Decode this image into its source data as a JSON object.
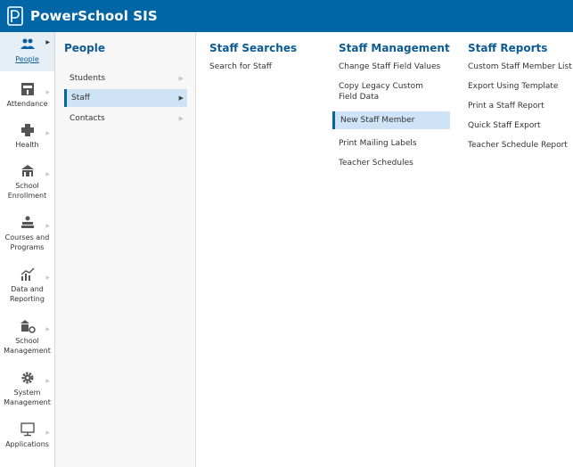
{
  "app": {
    "title": "PowerSchool SIS"
  },
  "rail": {
    "items": [
      {
        "label": "People"
      },
      {
        "label": "Attendance"
      },
      {
        "label": "Health"
      },
      {
        "label": "School Enrollment"
      },
      {
        "label": "Courses and Programs"
      },
      {
        "label": "Data and Reporting"
      },
      {
        "label": "School Management"
      },
      {
        "label": "System Management"
      },
      {
        "label": "Applications"
      }
    ]
  },
  "people_menu": {
    "title": "People",
    "items": [
      {
        "label": "Students"
      },
      {
        "label": "Staff"
      },
      {
        "label": "Contacts"
      }
    ]
  },
  "staff_panel": {
    "searches": {
      "title": "Staff Searches",
      "links": [
        "Search for Staff"
      ]
    },
    "management": {
      "title": "Staff Management",
      "links": [
        "Change Staff Field Values",
        "Copy Legacy Custom Field Data",
        "New Staff Member",
        "Print Mailing Labels",
        "Teacher Schedules"
      ]
    },
    "reports": {
      "title": "Staff Reports",
      "links": [
        "Custom Staff Member List",
        "Export Using Template",
        "Print a Staff Report",
        "Quick Staff Export",
        "Teacher Schedule Report"
      ]
    }
  },
  "colors": {
    "brand": "#0066a5",
    "heading": "#0d5b92",
    "active_bg": "#cfe3f6"
  }
}
